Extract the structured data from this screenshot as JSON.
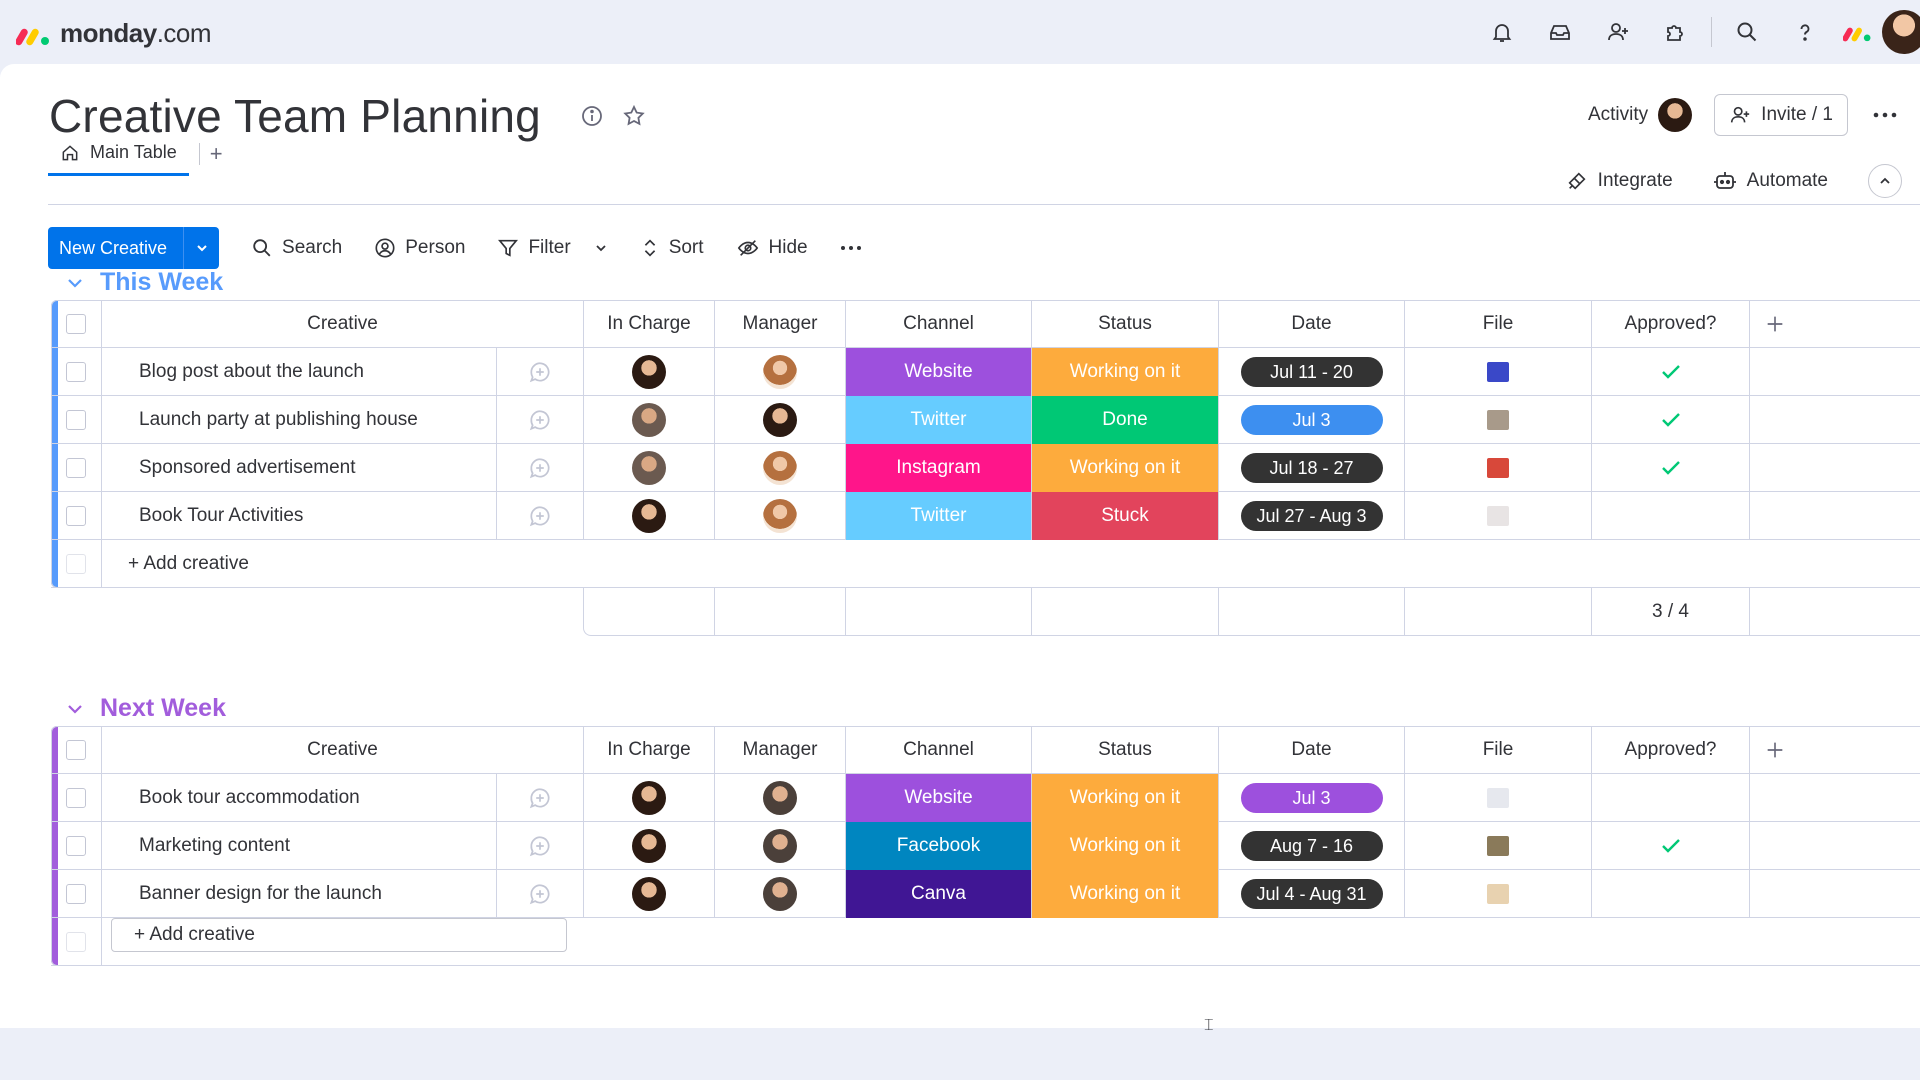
{
  "app": {
    "logo_main": "monday",
    "logo_tld": ".com"
  },
  "topbar_icons": [
    "bell-icon",
    "inbox-icon",
    "invite-members-icon",
    "apps-icon",
    "search-icon",
    "help-icon"
  ],
  "board": {
    "title": "Creative Team Planning"
  },
  "header": {
    "activity_label": "Activity",
    "invite_label": "Invite / 1"
  },
  "tabs": [
    {
      "label": "Main Table",
      "active": true
    }
  ],
  "tab_add": "+",
  "right_actions": {
    "integrate": "Integrate",
    "automate": "Automate"
  },
  "toolbar": {
    "new_item": "New Creative",
    "search": "Search",
    "person": "Person",
    "filter": "Filter",
    "sort": "Sort",
    "hide": "Hide"
  },
  "columns": {
    "creative": "Creative",
    "in_charge": "In Charge",
    "manager": "Manager",
    "channel": "Channel",
    "status": "Status",
    "date": "Date",
    "file": "File",
    "approved": "Approved?"
  },
  "colors": {
    "accent": "#0073ea",
    "website": "#9d50dd",
    "twitter": "#66ccff",
    "instagram": "#ff158a",
    "facebook": "#0086c0",
    "canva": "#401694",
    "working": "#fdab3d",
    "done": "#00c875",
    "stuck": "#e2445c",
    "group1": "#579bfc",
    "group2": "#a25ddc"
  },
  "groups": [
    {
      "title": "This Week",
      "color": "#579bfc",
      "add_label": "+ Add creative",
      "summary_approved": "3 / 4",
      "items": [
        {
          "name": "Blog post about the launch",
          "in_charge": "av-a",
          "manager": "av-c",
          "channel": "Website",
          "channel_color": "#9d50dd",
          "status": "Working on it",
          "status_color": "#fdab3d",
          "date": "Jul 11 - 20",
          "date_color": "#333333",
          "file_color": "#3a48c8",
          "approved": true
        },
        {
          "name": "Launch party at publishing house",
          "in_charge": "av-b",
          "manager": "av-a",
          "channel": "Twitter",
          "channel_color": "#66ccff",
          "status": "Done",
          "status_color": "#00c875",
          "date": "Jul 3",
          "date_color": "#3d8ff0",
          "file_color": "#a89a8a",
          "approved": true
        },
        {
          "name": "Sponsored advertisement",
          "in_charge": "av-b",
          "manager": "av-c",
          "channel": "Instagram",
          "channel_color": "#ff158a",
          "status": "Working on it",
          "status_color": "#fdab3d",
          "date": "Jul 18 - 27",
          "date_color": "#333333",
          "file_color": "#d8483a",
          "approved": true
        },
        {
          "name": "Book Tour Activities",
          "in_charge": "av-a",
          "manager": "av-c",
          "channel": "Twitter",
          "channel_color": "#66ccff",
          "status": "Stuck",
          "status_color": "#e2445c",
          "date": "Jul 27 - Aug 3",
          "date_color": "#333333",
          "file_color": "#e8e4e4",
          "approved": false
        }
      ]
    },
    {
      "title": "Next Week",
      "color": "#a25ddc",
      "add_label": "+ Add creative",
      "items": [
        {
          "name": "Book tour accommodation",
          "in_charge": "av-a",
          "manager": "av-d",
          "channel": "Website",
          "channel_color": "#9d50dd",
          "status": "Working on it",
          "status_color": "#fdab3d",
          "date": "Jul 3",
          "date_color": "#9d50dd",
          "file_color": "#e6e8ee",
          "approved": false
        },
        {
          "name": "Marketing content",
          "in_charge": "av-a",
          "manager": "av-d",
          "channel": "Facebook",
          "channel_color": "#0086c0",
          "status": "Working on it",
          "status_color": "#fdab3d",
          "date": "Aug 7 - 16",
          "date_color": "#333333",
          "file_color": "#8a7a5a",
          "approved": true
        },
        {
          "name": "Banner design for the launch",
          "in_charge": "av-a",
          "manager": "av-d",
          "channel": "Canva",
          "channel_color": "#401694",
          "status": "Working on it",
          "status_color": "#fdab3d",
          "date": "Jul 4 - Aug 31",
          "date_color": "#333333",
          "file_color": "#e8d2b0",
          "approved": false
        }
      ]
    }
  ]
}
